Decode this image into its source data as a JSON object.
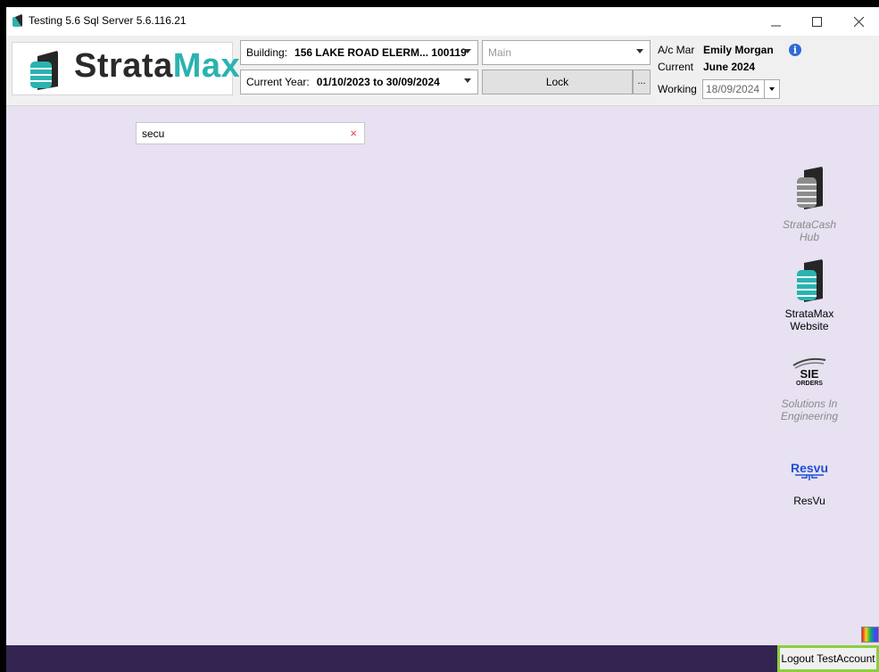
{
  "window": {
    "title": "Testing 5.6 Sql Server 5.6.116.21"
  },
  "header": {
    "logo": {
      "strata": "Strata",
      "max": "Max"
    },
    "building_label": "Building:",
    "building_value": "156 LAKE ROAD ELERM...  100119",
    "current_year_label": "Current Year:",
    "current_year_value": "01/10/2023  to  30/09/2024",
    "main_combo": "Main",
    "lock_label": "Lock",
    "more_label": "...",
    "acman_label": "A/c Mar",
    "acman_value": "Emily Morgan",
    "current_label": "Current",
    "current_value": "June 2024",
    "working_label": "Working",
    "working_date": "18/09/2024"
  },
  "search": {
    "value": "secu",
    "clear_glyph": "×"
  },
  "tiles": [
    {
      "label_lines": [
        "StrataCash Hub"
      ],
      "icon": "stratacash-icon"
    },
    {
      "label_lines": [
        "StrataMax",
        "Website"
      ],
      "icon": "stratamax-icon"
    },
    {
      "label_lines": [
        "Solutions In",
        "Engineering"
      ],
      "icon": "sie-orders-icon",
      "icon_text": [
        "SIE",
        "ORDERS"
      ]
    },
    {
      "label_lines": [
        "ResVu"
      ],
      "icon": "resvu-icon",
      "icon_text": [
        "Resvu"
      ]
    }
  ],
  "footer": {
    "logout_label": "Logout TestAccount"
  },
  "colors": {
    "accent_teal": "#2ab3b0",
    "main_bg": "#e7e1f1",
    "footer_bg": "#332451",
    "logout_border": "#8ccf3e"
  }
}
